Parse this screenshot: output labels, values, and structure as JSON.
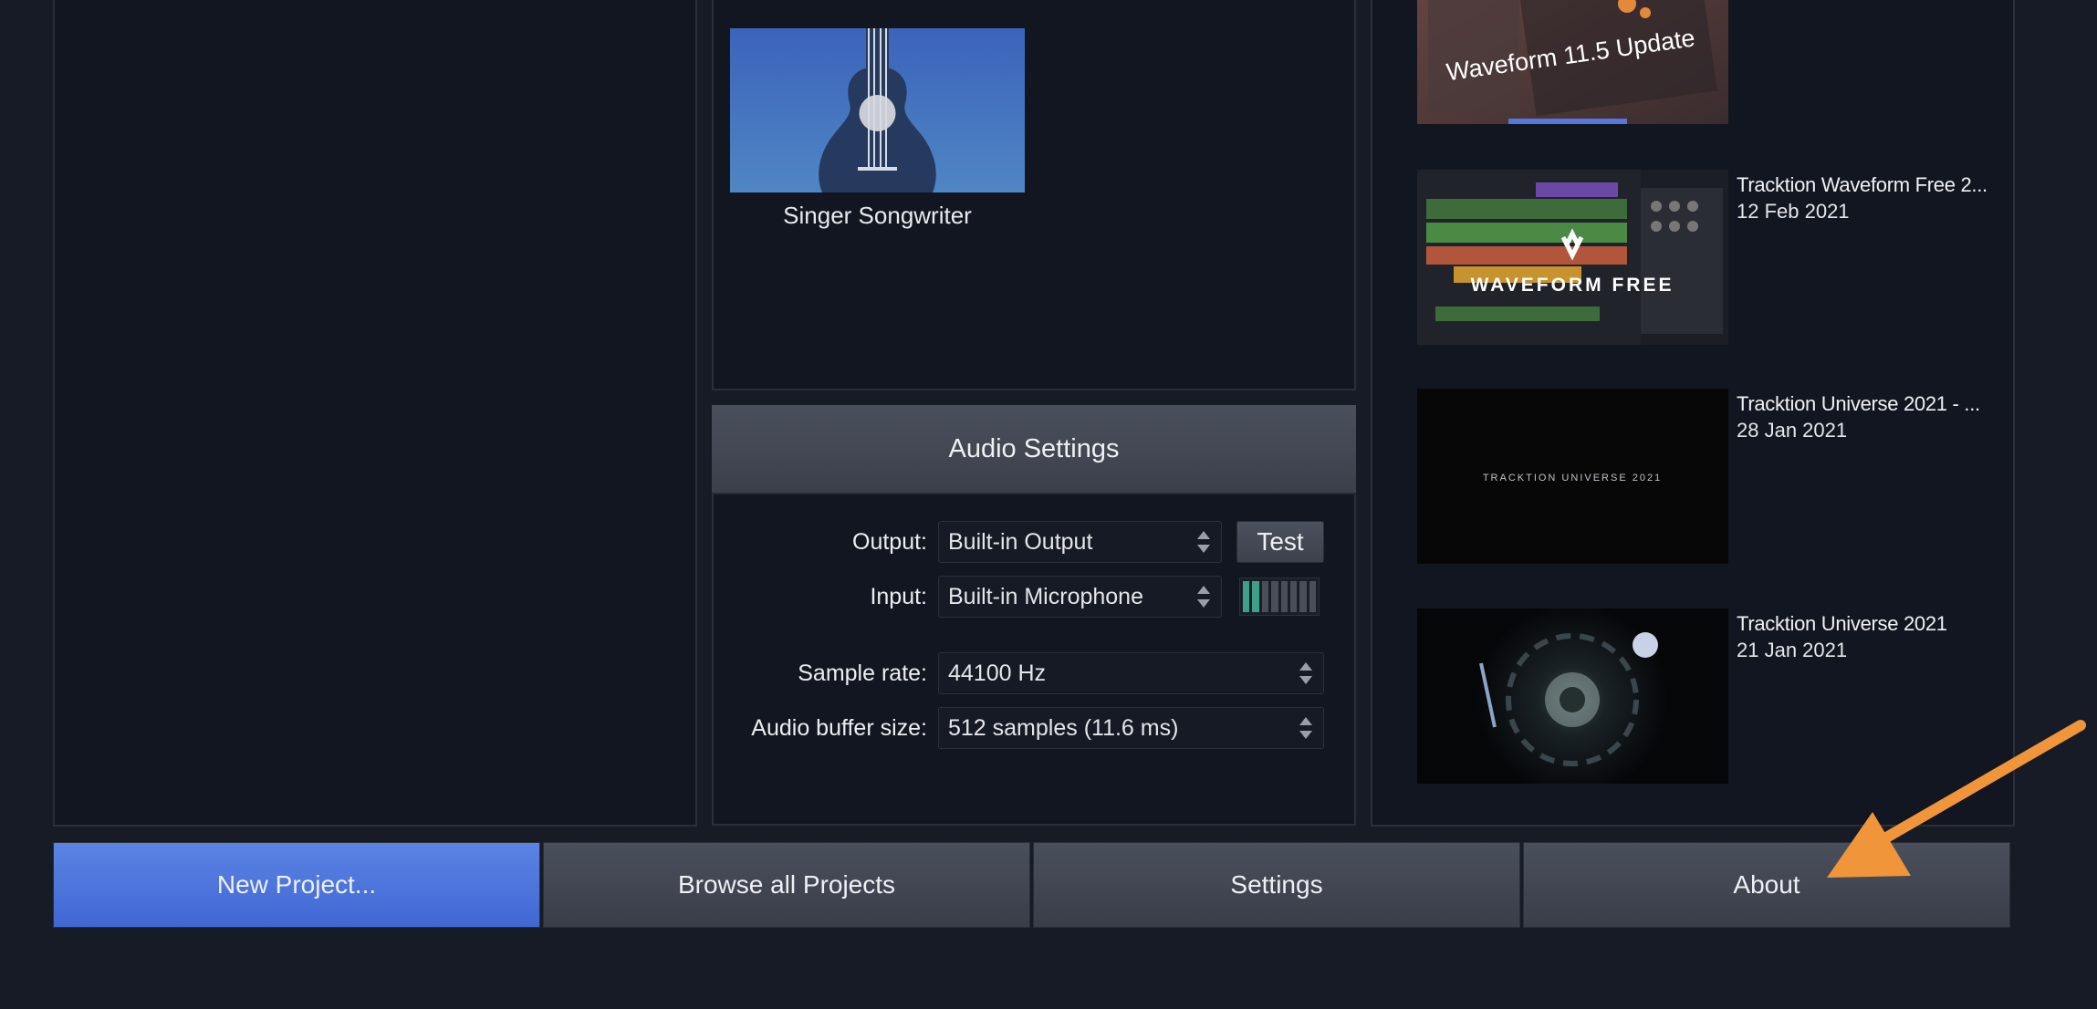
{
  "templates": [
    {
      "label": "Singer Songwriter"
    }
  ],
  "audio_settings": {
    "title": "Audio Settings",
    "output_label": "Output:",
    "output_value": "Built-in Output",
    "test_label": "Test",
    "input_label": "Input:",
    "input_value": "Built-in Microphone",
    "input_meter_level": 0.2,
    "sample_rate_label": "Sample rate:",
    "sample_rate_value": "44100 Hz",
    "buffer_label": "Audio buffer size:",
    "buffer_value": "512 samples (11.6 ms)"
  },
  "videos": [
    {
      "thumb_text": "Waveform 11.5 Update",
      "title": "",
      "date": ""
    },
    {
      "thumb_text": "WAVEFORM FREE",
      "title": "Tracktion Waveform Free 2...",
      "date": "12 Feb 2021"
    },
    {
      "thumb_text": "TRACKTION UNIVERSE 2021",
      "title": "Tracktion Universe 2021 - ...",
      "date": "28 Jan 2021"
    },
    {
      "thumb_text": "",
      "title": "Tracktion Universe 2021",
      "date": "21 Jan 2021"
    }
  ],
  "bottom_bar": {
    "new_project": "New Project...",
    "browse_projects": "Browse all Projects",
    "settings": "Settings",
    "about": "About"
  },
  "colors": {
    "background": "#171b26",
    "panel": "#121620",
    "accent_blue": "#4b74dc",
    "annotation_arrow": "#f0953a",
    "meter_green": "#3fa08a"
  }
}
